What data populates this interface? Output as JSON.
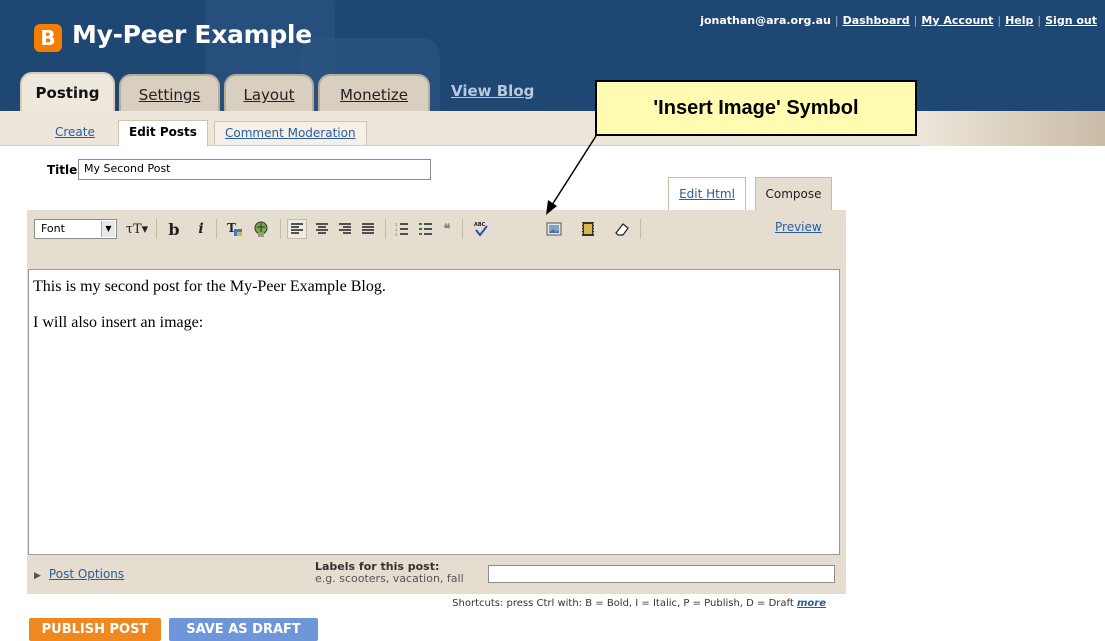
{
  "header": {
    "logo_letter": "B",
    "blog_title": "My-Peer Example",
    "user_email": "jonathan@ara.org.au",
    "top_links": [
      "Dashboard",
      "My Account",
      "Help",
      "Sign out"
    ]
  },
  "tabs": [
    {
      "label": "Posting",
      "active": true
    },
    {
      "label": "Settings",
      "active": false
    },
    {
      "label": "Layout",
      "active": false
    },
    {
      "label": "Monetize",
      "active": false
    }
  ],
  "view_blog": "View Blog",
  "subtabs": [
    {
      "label": "Create",
      "active": false
    },
    {
      "label": "Edit Posts",
      "active": true
    },
    {
      "label": "Comment Moderation",
      "active": false
    }
  ],
  "callout": {
    "text": "'Insert Image' Symbol"
  },
  "post": {
    "title_label": "Title:",
    "title_value": "My Second Post",
    "body_lines": [
      "This is my second post for the My-Peer Example Blog.",
      "I will also insert an image:"
    ]
  },
  "editor_modes": {
    "edit_html": "Edit Html",
    "compose": "Compose"
  },
  "toolbar": {
    "font_label": "Font",
    "preview": "Preview",
    "icons": [
      "font-size-icon",
      "bold-icon",
      "italic-icon",
      "text-color-icon",
      "link-icon",
      "align-left-icon",
      "align-center-icon",
      "align-right-icon",
      "align-justify-icon",
      "numbered-list-icon",
      "bullet-list-icon",
      "blockquote-icon",
      "spellcheck-icon",
      "insert-image-icon",
      "insert-video-icon",
      "remove-formatting-icon"
    ]
  },
  "post_options": "Post Options",
  "labels": {
    "heading": "Labels for this post:",
    "example": "e.g. scooters, vacation, fall",
    "value": ""
  },
  "shortcuts": {
    "text": "Shortcuts: press Ctrl with: B = Bold, I = Italic, P = Publish, D = Draft",
    "more": "more"
  },
  "buttons": {
    "publish": "PUBLISH POST",
    "draft": "SAVE AS DRAFT"
  },
  "colors": {
    "header_bg": "#1f4773",
    "logo_orange": "#f57d00",
    "publish_orange": "#f08820",
    "draft_blue": "#6d97d8",
    "callout_bg": "#fffcb1"
  }
}
